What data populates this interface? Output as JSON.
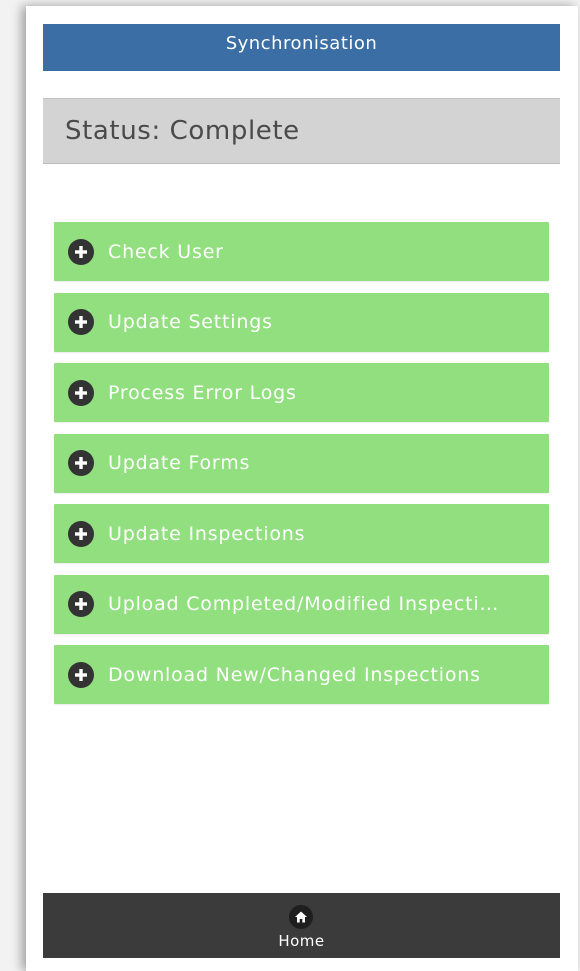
{
  "header": {
    "title": "Synchronisation"
  },
  "status": {
    "text": "Status: Complete"
  },
  "sync_steps": [
    {
      "label": "Check User",
      "icon": "plus-circle-icon"
    },
    {
      "label": "Update Settings",
      "icon": "plus-circle-icon"
    },
    {
      "label": "Process Error Logs",
      "icon": "plus-circle-icon"
    },
    {
      "label": "Update Forms",
      "icon": "plus-circle-icon"
    },
    {
      "label": "Update Inspections",
      "icon": "plus-circle-icon"
    },
    {
      "label": "Upload Completed/Modified Inspecti…",
      "icon": "plus-circle-icon"
    },
    {
      "label": "Download New/Changed Inspections",
      "icon": "plus-circle-icon"
    }
  ],
  "footer": {
    "home_label": "Home",
    "home_icon": "home-icon"
  },
  "colors": {
    "header_bg": "#3a6ea5",
    "status_bg": "#d3d3d3",
    "step_bg": "#91df7f",
    "footer_bg": "#3b3b3b"
  }
}
